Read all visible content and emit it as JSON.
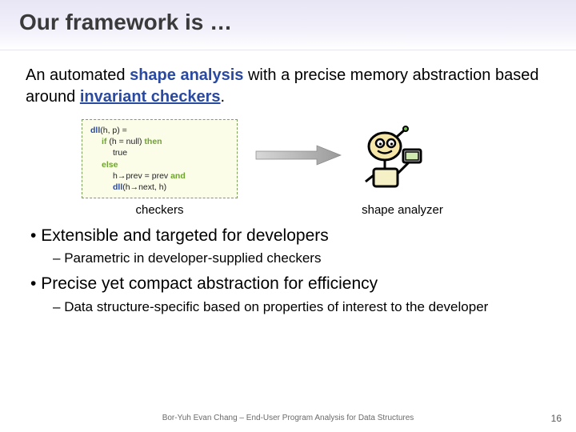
{
  "title": "Our framework is …",
  "intro": {
    "pre": "An automated ",
    "shape": "shape analysis",
    "mid": " with a precise memory abstraction based around ",
    "inv": "invariant checkers",
    "post": "."
  },
  "code": {
    "l1a": "dll",
    "l1b": "(h, p) =",
    "l2a": "if",
    "l2b": " (h = null) ",
    "l2c": "then",
    "l3": "true",
    "l4": "else",
    "l5a": "h→prev = prev ",
    "l5b": "and",
    "l6a": "dll",
    "l6b": "(h→next, h)"
  },
  "captions": {
    "left": "checkers",
    "right": "shape analyzer"
  },
  "bullets": {
    "b1": "Extensible and targeted for developers",
    "s1": "Parametric in developer-supplied checkers",
    "b2": "Precise yet compact abstraction for efficiency",
    "s2": "Data structure-specific based on properties of interest to the developer"
  },
  "footer": "Bor-Yuh Evan Chang – End-User Program Analysis for Data Structures",
  "page": "16"
}
